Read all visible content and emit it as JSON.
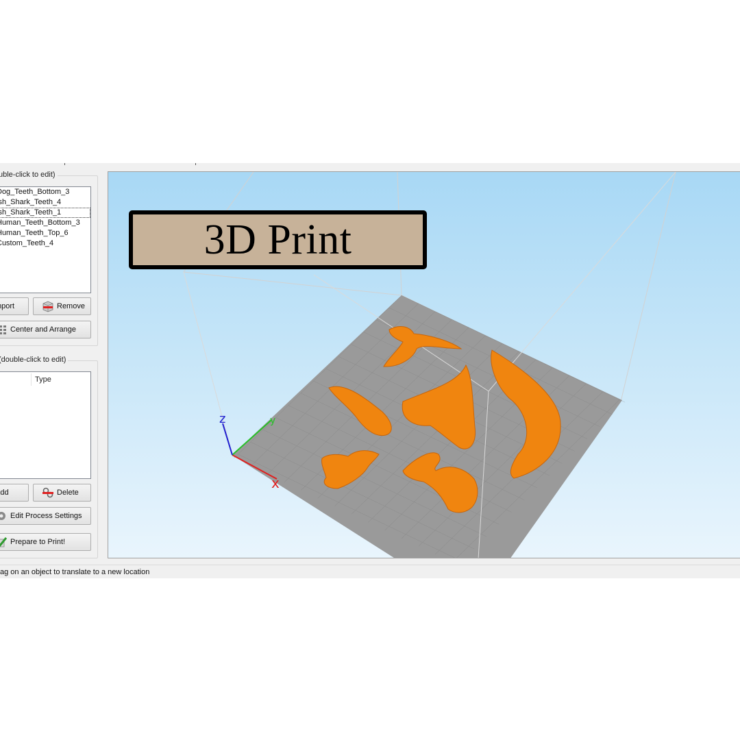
{
  "objects_panel": {
    "title": "uble-click to edit)",
    "items": [
      "Dog_Teeth_Bottom_3",
      "ish_Shark_Teeth_4",
      "ish_Shark_Teeth_1",
      "Human_Teeth_Bottom_3",
      "Human_Teeth_Top_6",
      "Custom_Teeth_4"
    ],
    "selected_index": 2,
    "import_label": "mport",
    "remove_label": "Remove",
    "center_arrange_label": "Center and Arrange"
  },
  "process_panel": {
    "title": "(double-click to edit)",
    "type_header": "Type",
    "add_label": "Add",
    "delete_label": "Delete",
    "edit_settings_label": "Edit Process Settings",
    "prepare_label": "Prepare to Print!"
  },
  "viewport": {
    "axis_x": "x",
    "axis_y": "y",
    "axis_z": "z",
    "model_color": "#f0850f",
    "bed_color": "#9a9a9a"
  },
  "overlay": {
    "title": "3D Print",
    "background": "#c7b299"
  },
  "status_bar": {
    "text": "ag on an object to translate to a new location"
  }
}
